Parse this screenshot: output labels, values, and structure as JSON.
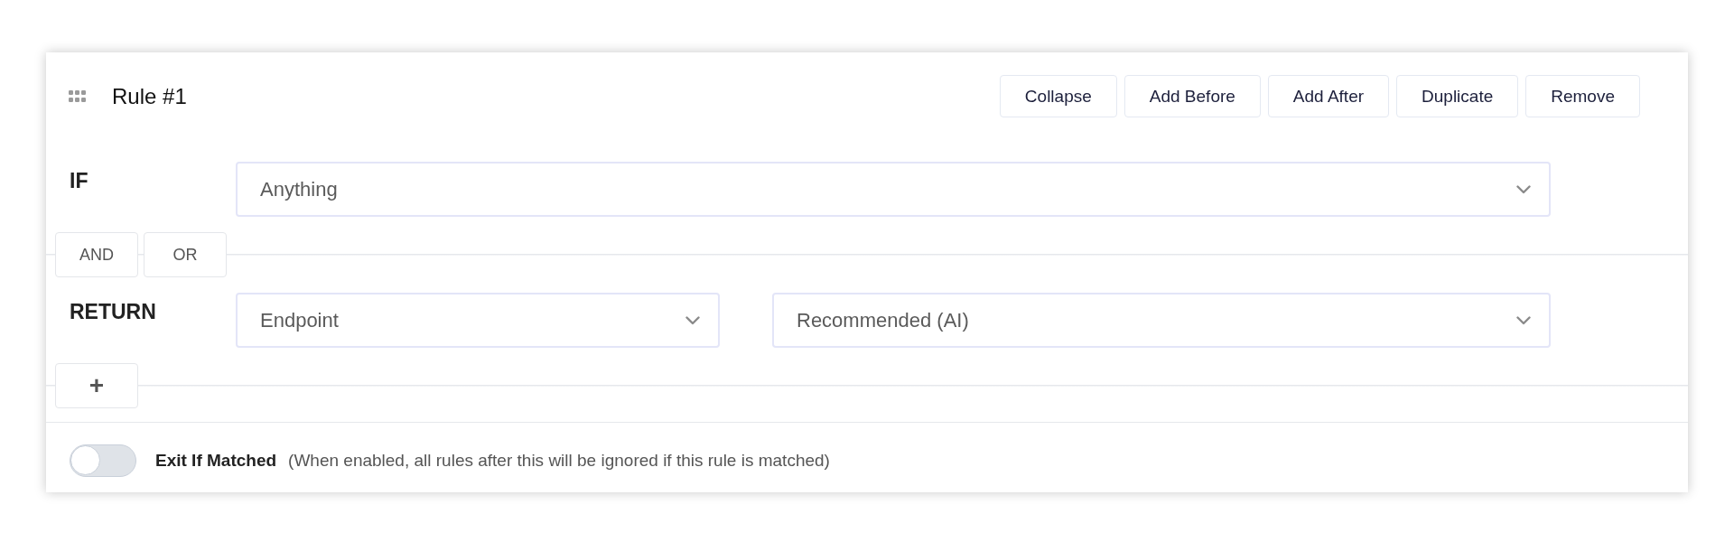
{
  "header": {
    "title": "Rule #1",
    "buttons": [
      "Collapse",
      "Add Before",
      "Add After",
      "Duplicate",
      "Remove"
    ]
  },
  "if_row": {
    "label": "IF",
    "select": {
      "value": "Anything"
    }
  },
  "logic_buttons": [
    "AND",
    "OR"
  ],
  "return_row": {
    "label": "RETURN",
    "selects": [
      {
        "value": "Endpoint"
      },
      {
        "value": "Recommended (AI)"
      }
    ]
  },
  "add_button": "+",
  "footer": {
    "toggle": {
      "label": "Exit If Matched",
      "on": false
    },
    "description": "(When enabled, all rules after this will be ignored if this rule is matched)"
  }
}
